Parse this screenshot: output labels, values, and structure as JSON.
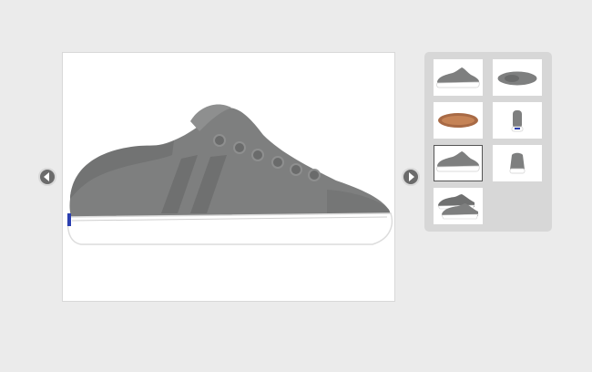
{
  "gallery": {
    "main_image": {
      "icon": "sneaker-side-view",
      "colors": {
        "upper": "#7e7f7f",
        "upper_light": "#8e8f8f",
        "sole": "#ffffff",
        "sole_edge": "#dcdcdc",
        "heel_accent": "#2b3fb0"
      }
    },
    "prev_button": {
      "icon": "chevron-left-icon"
    },
    "next_button": {
      "icon": "chevron-right-icon"
    },
    "thumbnails": [
      {
        "view": "side",
        "active": false
      },
      {
        "view": "top",
        "active": false
      },
      {
        "view": "sole",
        "active": false
      },
      {
        "view": "heel",
        "active": false
      },
      {
        "view": "side",
        "active": true
      },
      {
        "view": "front",
        "active": false
      },
      {
        "view": "pair",
        "active": false
      }
    ]
  }
}
